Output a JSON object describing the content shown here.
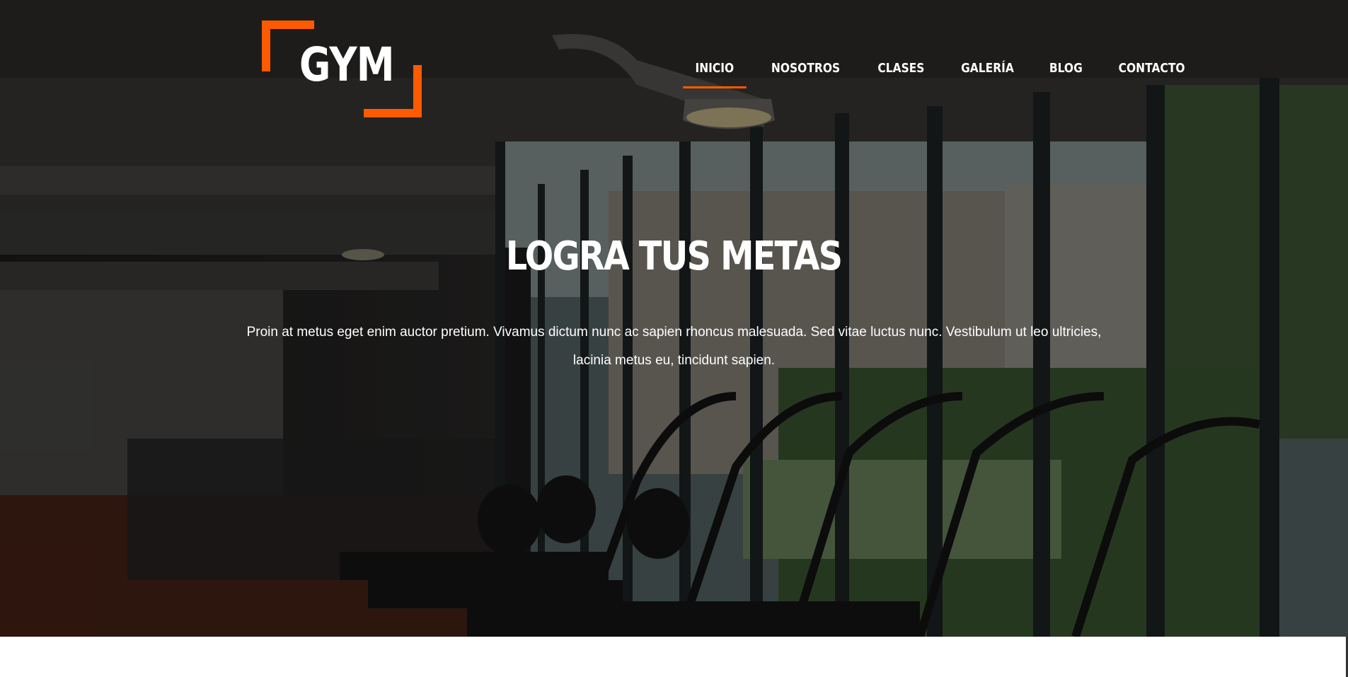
{
  "brand": {
    "logo_text": "GYM",
    "accent_color": "#ff5a00"
  },
  "nav": {
    "items": [
      {
        "label": "INICIO",
        "active": true
      },
      {
        "label": "NOSOTROS",
        "active": false
      },
      {
        "label": "CLASES",
        "active": false
      },
      {
        "label": "GALERÍA",
        "active": false
      },
      {
        "label": "BLOG",
        "active": false
      },
      {
        "label": "CONTACTO",
        "active": false
      }
    ]
  },
  "hero": {
    "title": "LOGRA TUS METAS",
    "description": "Proin at metus eget enim auctor pretium. Vivamus dictum nunc ac sapien rhoncus malesuada. Sed vitae luctus nunc. Vestibulum ut leo ultricies, lacinia metus eu, tincidunt sapien.",
    "background": "gym-interior-photo"
  }
}
